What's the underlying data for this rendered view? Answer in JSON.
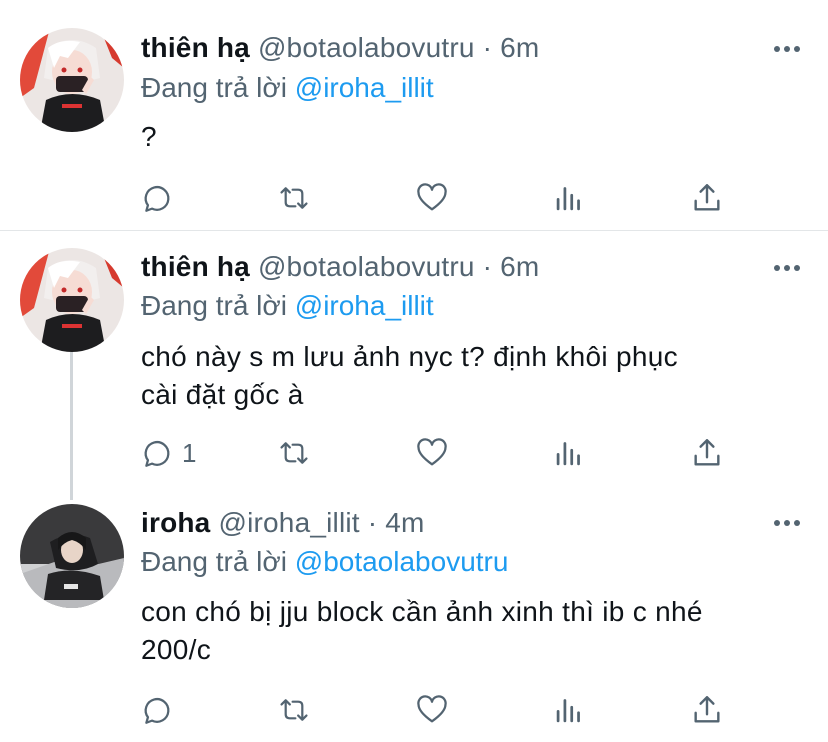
{
  "tweets": [
    {
      "name": "thiên hạ",
      "handle": "@botaolabovutru",
      "dot": "·",
      "time": "6m",
      "reply_prefix": "Đang trả lời",
      "reply_to": "@iroha_illit",
      "lines": [
        "?"
      ],
      "reply_count": "",
      "avatar": "avatar-anime-masked"
    },
    {
      "name": "thiên hạ",
      "handle": "@botaolabovutru",
      "dot": "·",
      "time": "6m",
      "reply_prefix": "Đang trả lời",
      "reply_to": "@iroha_illit",
      "lines": [
        "chó này s m lưu ảnh nyc t? định khôi phục",
        "cài đặt gốc à"
      ],
      "reply_count": "1",
      "avatar": "avatar-anime-masked"
    },
    {
      "name": "iroha",
      "handle": "@iroha_illit",
      "dot": "·",
      "time": "4m",
      "reply_prefix": "Đang trả lời",
      "reply_to": "@botaolabovutru",
      "lines": [
        "con chó bị jju block cần ảnh xinh thì ib c nhé",
        "200/c"
      ],
      "reply_count": "",
      "avatar": "avatar-photo-girl"
    }
  ],
  "icons": {
    "reply": "reply-icon",
    "retweet": "retweet-icon",
    "like": "heart-icon",
    "analytics": "analytics-icon",
    "share": "share-icon",
    "more": "more-icon"
  },
  "colors": {
    "link": "#1d9bf0",
    "secondary_text": "#536471",
    "primary_text": "#0f1419"
  }
}
